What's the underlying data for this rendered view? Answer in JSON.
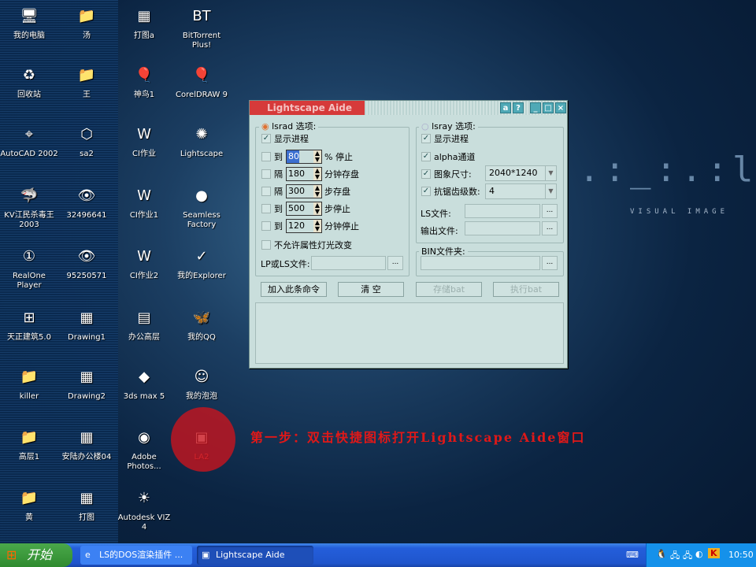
{
  "desktop": {
    "icons": [
      {
        "label": "我的电脑",
        "glyph": "🖥"
      },
      {
        "label": "回收站",
        "glyph": "♻"
      },
      {
        "label": "AutoCAD 2002",
        "glyph": "⌖"
      },
      {
        "label": "KV江民杀毒王 2003",
        "glyph": "🦈"
      },
      {
        "label": "RealOne Player",
        "glyph": "①"
      },
      {
        "label": "天正建筑5.0",
        "glyph": "⊞"
      },
      {
        "label": "killer",
        "glyph": "📁"
      },
      {
        "label": "高层1",
        "glyph": "📁"
      },
      {
        "label": "黄",
        "glyph": "📁"
      },
      {
        "label": "汤",
        "glyph": "📁"
      },
      {
        "label": "王",
        "glyph": "📁"
      },
      {
        "label": "sa2",
        "glyph": "⬡"
      },
      {
        "label": "32496641",
        "glyph": "👁"
      },
      {
        "label": "95250571",
        "glyph": "👁"
      },
      {
        "label": "Drawing1",
        "glyph": "▦"
      },
      {
        "label": "Drawing2",
        "glyph": "▦"
      },
      {
        "label": "安陆办公楼04",
        "glyph": "▦"
      },
      {
        "label": "打图",
        "glyph": "▦"
      },
      {
        "label": "打图a",
        "glyph": "▦"
      },
      {
        "label": "神鸟1",
        "glyph": "🎈"
      },
      {
        "label": "CI作业",
        "glyph": "W"
      },
      {
        "label": "CI作业1",
        "glyph": "W"
      },
      {
        "label": "CI作业2",
        "glyph": "W"
      },
      {
        "label": "办公高层",
        "glyph": "▤"
      },
      {
        "label": "3ds max 5",
        "glyph": "◆"
      },
      {
        "label": "Adobe Photos...",
        "glyph": "◉"
      },
      {
        "label": "Autodesk VIZ 4",
        "glyph": "☀"
      },
      {
        "label": "BitTorrent Plus!",
        "glyph": "BT"
      },
      {
        "label": "CorelDRAW 9",
        "glyph": "🎈"
      },
      {
        "label": "Lightscape",
        "glyph": "✺"
      },
      {
        "label": "Seamless Factory",
        "glyph": "●"
      },
      {
        "label": "我的Explorer",
        "glyph": "✓"
      },
      {
        "label": "我的QQ",
        "glyph": "🦋"
      },
      {
        "label": "我的泡泡",
        "glyph": "☺"
      },
      {
        "label": "LA2",
        "glyph": "▣"
      }
    ]
  },
  "instruction": "第一步：双击快捷图标打开Lightscape Aide窗口",
  "dialog": {
    "title": "Lightscape Aide",
    "title_buttons": [
      "a",
      "?",
      "_",
      "□",
      "×"
    ],
    "lsrad": {
      "label": "lsrad 选项:",
      "show_progress": "显示进程",
      "rows": [
        {
          "prefix": "到",
          "value": "80",
          "suffix": "% 停止"
        },
        {
          "prefix": "隔",
          "value": "180",
          "suffix": "分钟存盘"
        },
        {
          "prefix": "隔",
          "value": "300",
          "suffix": "步存盘"
        },
        {
          "prefix": "到",
          "value": "500",
          "suffix": "步停止"
        },
        {
          "prefix": "到",
          "value": "120",
          "suffix": "分钟停止"
        }
      ],
      "no_light_change": "不允许属性灯光改变",
      "file_label": "LP或LS文件:"
    },
    "lsray": {
      "label": "lsray 选项:",
      "show_progress": "显示进程",
      "alpha": "alpha通道",
      "size_label": "图象尺寸:",
      "size_value": "2040*1240",
      "aa_label": "抗锯齿级数:",
      "aa_value": "4",
      "ls_file": "LS文件:",
      "output_file": "输出文件:"
    },
    "bin_folder": "BIN文件夹:",
    "browse": "...",
    "buttons": {
      "add": "加入此条命令",
      "clear": "清  空",
      "save": "存储bat",
      "run": "执行bat"
    }
  },
  "taskbar": {
    "start": "开始",
    "items": [
      "LS的DOS渲染插件 ...",
      "Lightscape Aide"
    ],
    "clock": "10:50"
  }
}
